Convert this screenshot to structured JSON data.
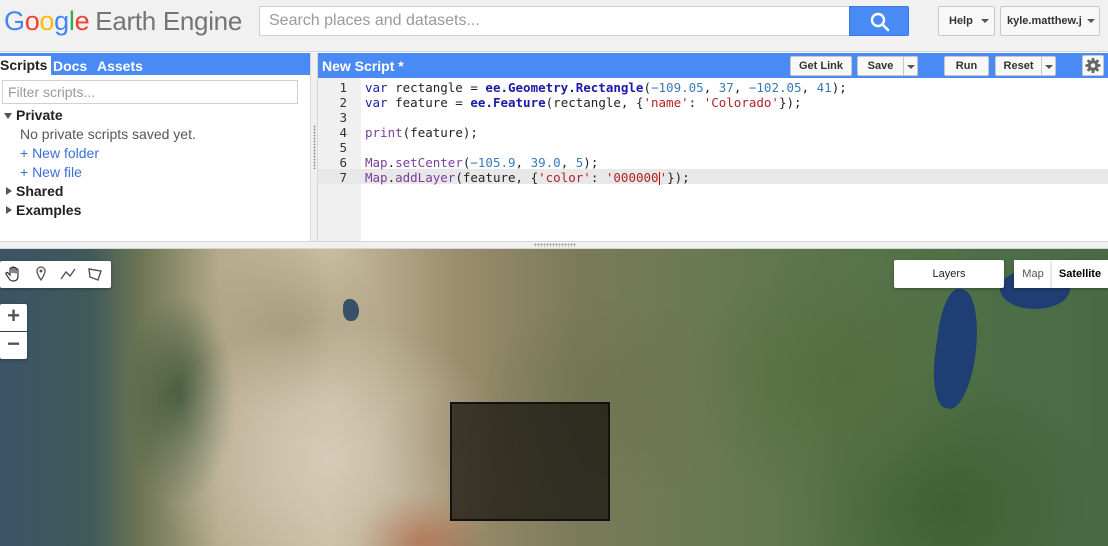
{
  "header": {
    "logo_letters": [
      "G",
      "o",
      "o",
      "g",
      "l",
      "e"
    ],
    "logo_colors": [
      "#4285f4",
      "#ea4335",
      "#fbbc05",
      "#4285f4",
      "#34a853",
      "#ea4335"
    ],
    "logo_rest": "Earth Engine",
    "search_placeholder": "Search places and datasets...",
    "help_label": "Help",
    "user_label": "kyle.matthew.j"
  },
  "left_panel": {
    "tabs": [
      {
        "label": "Scripts",
        "active": true
      },
      {
        "label": "Docs",
        "active": false
      },
      {
        "label": "Assets",
        "active": false
      }
    ],
    "filter_placeholder": "Filter scripts...",
    "private_label": "Private",
    "private_empty": "No private scripts saved yet.",
    "new_folder": "+ New folder",
    "new_file": "+ New file",
    "shared_label": "Shared",
    "examples_label": "Examples"
  },
  "editor": {
    "title": "New Script *",
    "get_link": "Get Link",
    "save": "Save",
    "run": "Run",
    "reset": "Reset",
    "line_numbers": [
      "1",
      "2",
      "3",
      "4",
      "5",
      "6",
      "7"
    ]
  },
  "map": {
    "layers_label": "Layers",
    "map_label": "Map",
    "satellite_label": "Satellite",
    "zoom_in": "+",
    "zoom_out": "−",
    "feature_color": "#000000"
  },
  "colors": {
    "accent": "#4a8af4",
    "link": "#3b6fd8"
  }
}
